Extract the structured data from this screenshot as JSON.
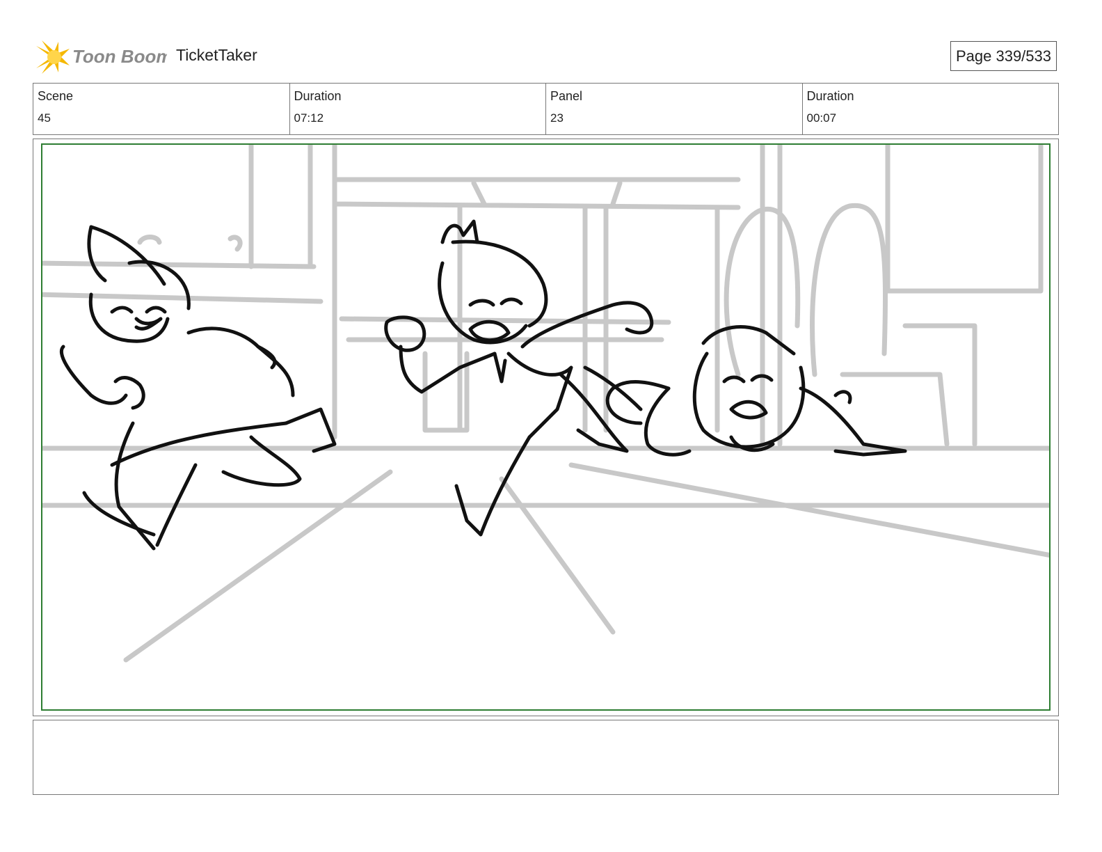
{
  "header": {
    "logo_text": "Toon Boom",
    "project_title": "TicketTaker",
    "page_label": "Page 339/533"
  },
  "info": {
    "scene_label": "Scene",
    "scene_value": "45",
    "scene_duration_label": "Duration",
    "scene_duration_value": "07:12",
    "panel_label": "Panel",
    "panel_value": "23",
    "panel_duration_label": "Duration",
    "panel_duration_value": "00:07"
  },
  "panel": {
    "frame_color": "#2e7d32",
    "sketch_line_color": "#111111",
    "background_line_color": "#c8c8c8"
  },
  "notes": {
    "text": ""
  }
}
